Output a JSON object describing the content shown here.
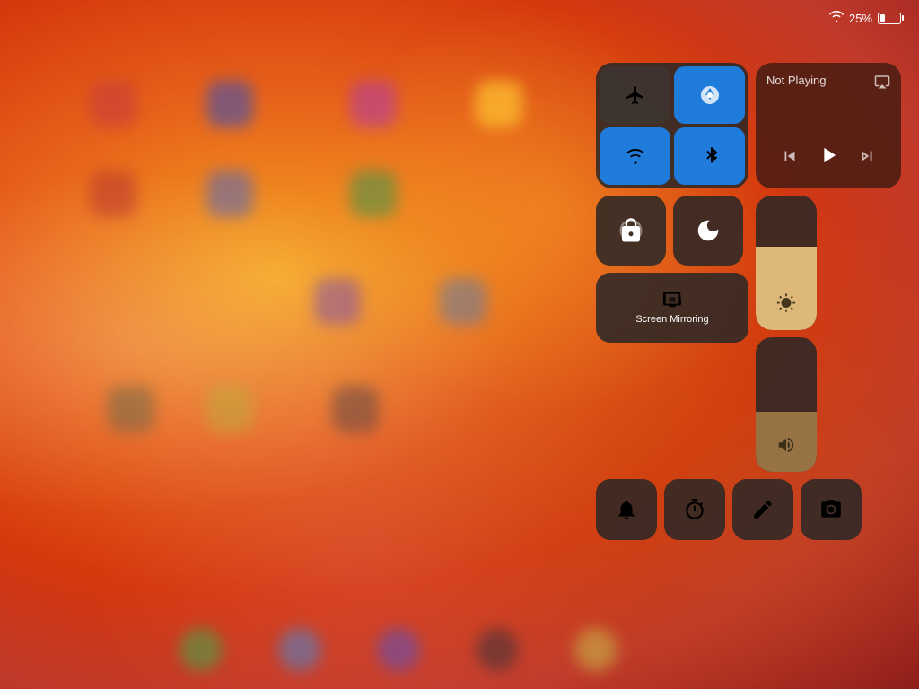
{
  "statusBar": {
    "battery_percent": "25%",
    "wifi_label": "WiFi",
    "battery_label": "Battery"
  },
  "controlCenter": {
    "connectivity": {
      "airplane_label": "Airplane Mode",
      "airdrop_label": "AirDrop",
      "wifi_label": "Wi-Fi",
      "bluetooth_label": "Bluetooth",
      "airplane_active": false,
      "airdrop_active": true,
      "wifi_active": true,
      "bluetooth_active": true
    },
    "media": {
      "not_playing_label": "Not Playing",
      "airplay_label": "AirPlay",
      "rewind_label": "Rewind",
      "play_label": "Play",
      "fastforward_label": "Fast Forward"
    },
    "rotation_lock_label": "Rotation Lock",
    "do_not_disturb_label": "Do Not Disturb",
    "screen_mirroring_label": "Screen\nMirroring",
    "brightness_label": "Brightness",
    "volume_label": "Volume",
    "alarm_label": "Alarm",
    "timer_label": "Timer",
    "notes_label": "Notes",
    "camera_label": "Camera",
    "brightness_value": 62,
    "volume_value": 45
  }
}
